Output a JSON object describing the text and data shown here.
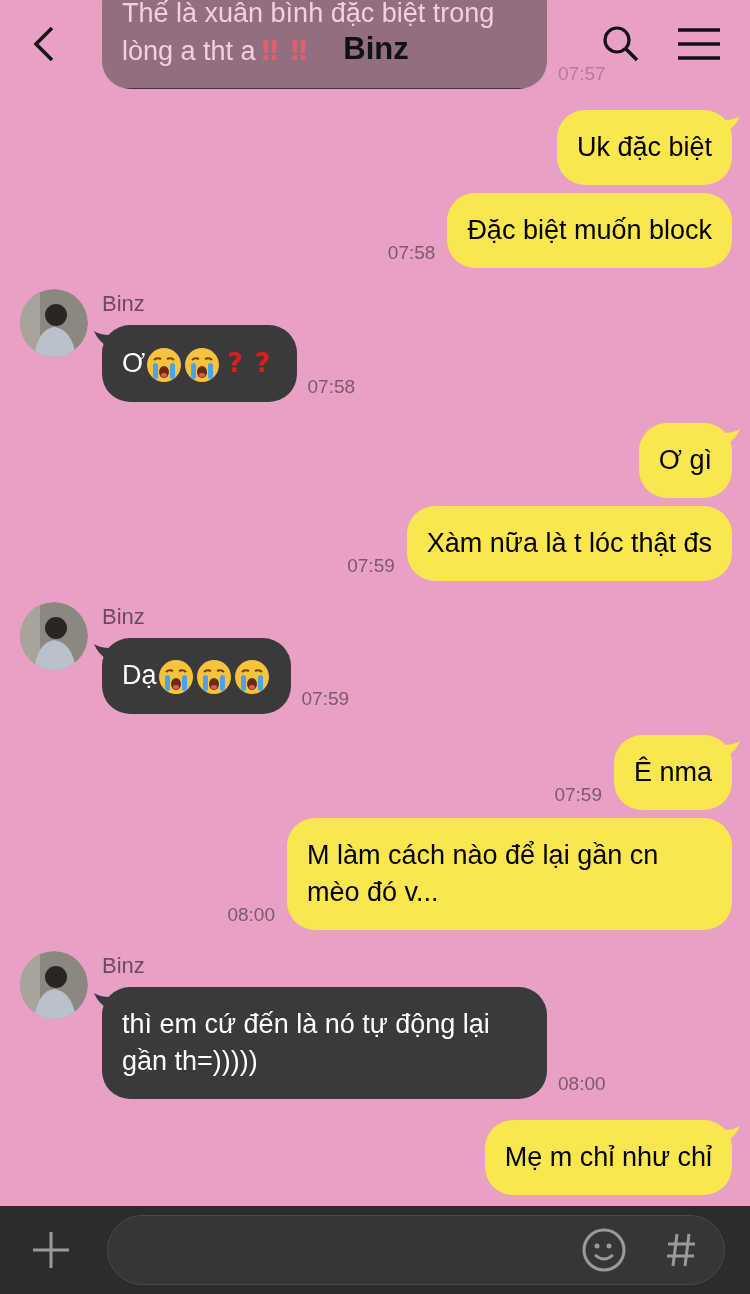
{
  "header": {
    "title": "Binz"
  },
  "messages": [
    {
      "kind": "incoming",
      "parts": [
        {
          "kind": "text",
          "text": "Thế là xuân bình đặc biệt trong lòng a tht a"
        },
        {
          "kind": "red-mark",
          "text": "‼"
        },
        {
          "kind": "red-mark",
          "text": "‼"
        }
      ],
      "time": "07:57"
    },
    {
      "kind": "outgoing",
      "parts": [
        {
          "kind": "text",
          "text": "Uk đặc biệt"
        }
      ]
    },
    {
      "kind": "outgoing",
      "parts": [
        {
          "kind": "text",
          "text": "Đặc biệt muốn block"
        }
      ],
      "time": "07:58"
    },
    {
      "kind": "incoming",
      "sender": "Binz",
      "parts": [
        {
          "kind": "text",
          "text": "Ơ"
        },
        {
          "kind": "crying"
        },
        {
          "kind": "crying"
        },
        {
          "kind": "red-mark",
          "text": "?"
        },
        {
          "kind": "red-mark",
          "text": "?"
        }
      ],
      "time": "07:58"
    },
    {
      "kind": "outgoing",
      "parts": [
        {
          "kind": "text",
          "text": "Ơ gì"
        }
      ]
    },
    {
      "kind": "outgoing",
      "parts": [
        {
          "kind": "text",
          "text": "Xàm nữa là t lóc thật đs"
        }
      ],
      "time": "07:59"
    },
    {
      "kind": "incoming",
      "sender": "Binz",
      "parts": [
        {
          "kind": "text",
          "text": "Dạ"
        },
        {
          "kind": "crying"
        },
        {
          "kind": "crying"
        },
        {
          "kind": "crying"
        }
      ],
      "time": "07:59"
    },
    {
      "kind": "outgoing",
      "parts": [
        {
          "kind": "text",
          "text": "Ê nma"
        }
      ],
      "time": "07:59"
    },
    {
      "kind": "outgoing",
      "parts": [
        {
          "kind": "text",
          "text": "M làm cách nào để lại gần cn mèo đó v..."
        }
      ],
      "time": "08:00"
    },
    {
      "kind": "incoming",
      "sender": "Binz",
      "parts": [
        {
          "kind": "text",
          "text": "thì em cứ đến là nó tự động lại gần th=)))))"
        }
      ],
      "time": "08:00"
    },
    {
      "kind": "outgoing",
      "parts": [
        {
          "kind": "text",
          "text": "Mẹ m chỉ như chỉ"
        }
      ]
    }
  ]
}
